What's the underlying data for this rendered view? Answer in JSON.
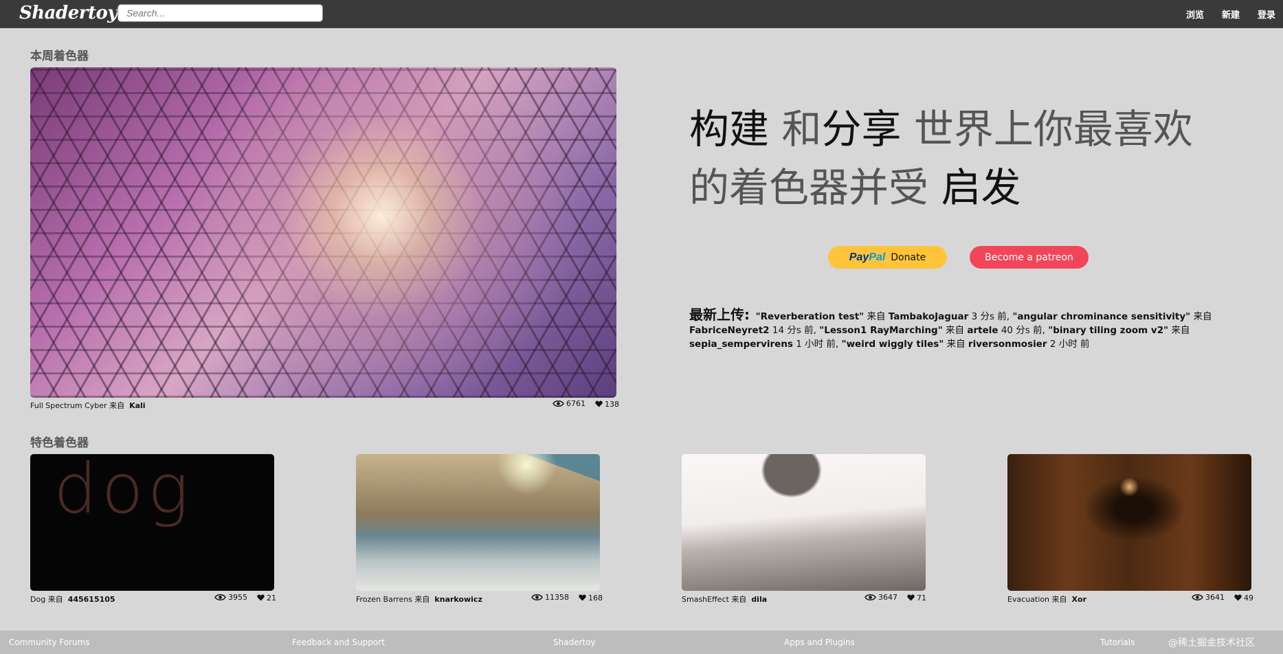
{
  "header": {
    "logo": "Shadertoy",
    "search_placeholder": "Search...",
    "nav": [
      "浏览",
      "新建",
      "登录"
    ]
  },
  "shader_of_week": {
    "section_title": "本周着色器",
    "title": "Full Spectrum Cyber",
    "by": "来自",
    "author": "Kali",
    "views": "6761",
    "likes": "138"
  },
  "hero": {
    "w1": "构建",
    "w2": "和",
    "w3": "分享",
    "w4": "世界上你最喜欢的着色器并受",
    "w5": "启发"
  },
  "donate": {
    "paypal_pay": "Pay",
    "paypal_pal": "Pal",
    "paypal_label": "Donate",
    "patreon_label": "Become a patreon"
  },
  "latest": {
    "label": "最新上传:",
    "items": [
      {
        "title": "\"Reverberation test\"",
        "by": "来自",
        "author": "TambakoJaguar",
        "time": "3 分s 前,"
      },
      {
        "title": "\"angular chrominance sensitivity\"",
        "by": "来自",
        "author": "FabriceNeyret2",
        "time": "14 分s 前,"
      },
      {
        "title": "\"Lesson1 RayMarching\"",
        "by": "来自",
        "author": "artele",
        "time": "40 分s 前,"
      },
      {
        "title": "\"binary tiling zoom v2\"",
        "by": "来自",
        "author": "sepia_sempervirens",
        "time": "1 小时 前,"
      },
      {
        "title": "\"weird wiggly tiles\"",
        "by": "来自",
        "author": "riversonmosier",
        "time": "2 小时 前"
      }
    ]
  },
  "featured": {
    "section_title": "特色着色器",
    "items": [
      {
        "title": "Dog",
        "by": "来自",
        "author": "445615105",
        "views": "3955",
        "likes": "21",
        "thumb_text": "dog"
      },
      {
        "title": "Frozen Barrens",
        "by": "来自",
        "author": "knarkowicz",
        "views": "11358",
        "likes": "168"
      },
      {
        "title": "SmashEffect",
        "by": "来自",
        "author": "dila",
        "views": "3647",
        "likes": "71"
      },
      {
        "title": "Evacuation",
        "by": "来自",
        "author": "Xor",
        "views": "3641",
        "likes": "49"
      }
    ]
  },
  "footer": {
    "links": [
      "Community Forums",
      "Feedback and Support",
      "Shadertoy",
      "Apps and Plugins",
      "Tutorials"
    ],
    "watermark": "@稀土掘金技术社区"
  }
}
